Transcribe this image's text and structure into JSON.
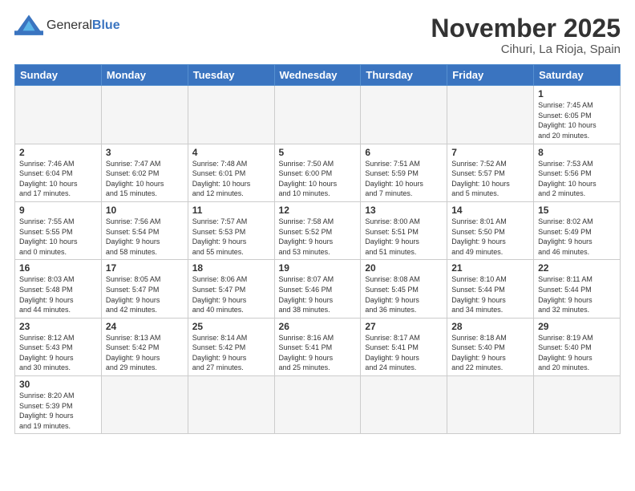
{
  "header": {
    "logo_general": "General",
    "logo_blue": "Blue",
    "month": "November 2025",
    "location": "Cihuri, La Rioja, Spain"
  },
  "weekdays": [
    "Sunday",
    "Monday",
    "Tuesday",
    "Wednesday",
    "Thursday",
    "Friday",
    "Saturday"
  ],
  "weeks": [
    [
      {
        "day": "",
        "info": ""
      },
      {
        "day": "",
        "info": ""
      },
      {
        "day": "",
        "info": ""
      },
      {
        "day": "",
        "info": ""
      },
      {
        "day": "",
        "info": ""
      },
      {
        "day": "",
        "info": ""
      },
      {
        "day": "1",
        "info": "Sunrise: 7:45 AM\nSunset: 6:05 PM\nDaylight: 10 hours\nand 20 minutes."
      }
    ],
    [
      {
        "day": "2",
        "info": "Sunrise: 7:46 AM\nSunset: 6:04 PM\nDaylight: 10 hours\nand 17 minutes."
      },
      {
        "day": "3",
        "info": "Sunrise: 7:47 AM\nSunset: 6:02 PM\nDaylight: 10 hours\nand 15 minutes."
      },
      {
        "day": "4",
        "info": "Sunrise: 7:48 AM\nSunset: 6:01 PM\nDaylight: 10 hours\nand 12 minutes."
      },
      {
        "day": "5",
        "info": "Sunrise: 7:50 AM\nSunset: 6:00 PM\nDaylight: 10 hours\nand 10 minutes."
      },
      {
        "day": "6",
        "info": "Sunrise: 7:51 AM\nSunset: 5:59 PM\nDaylight: 10 hours\nand 7 minutes."
      },
      {
        "day": "7",
        "info": "Sunrise: 7:52 AM\nSunset: 5:57 PM\nDaylight: 10 hours\nand 5 minutes."
      },
      {
        "day": "8",
        "info": "Sunrise: 7:53 AM\nSunset: 5:56 PM\nDaylight: 10 hours\nand 2 minutes."
      }
    ],
    [
      {
        "day": "9",
        "info": "Sunrise: 7:55 AM\nSunset: 5:55 PM\nDaylight: 10 hours\nand 0 minutes."
      },
      {
        "day": "10",
        "info": "Sunrise: 7:56 AM\nSunset: 5:54 PM\nDaylight: 9 hours\nand 58 minutes."
      },
      {
        "day": "11",
        "info": "Sunrise: 7:57 AM\nSunset: 5:53 PM\nDaylight: 9 hours\nand 55 minutes."
      },
      {
        "day": "12",
        "info": "Sunrise: 7:58 AM\nSunset: 5:52 PM\nDaylight: 9 hours\nand 53 minutes."
      },
      {
        "day": "13",
        "info": "Sunrise: 8:00 AM\nSunset: 5:51 PM\nDaylight: 9 hours\nand 51 minutes."
      },
      {
        "day": "14",
        "info": "Sunrise: 8:01 AM\nSunset: 5:50 PM\nDaylight: 9 hours\nand 49 minutes."
      },
      {
        "day": "15",
        "info": "Sunrise: 8:02 AM\nSunset: 5:49 PM\nDaylight: 9 hours\nand 46 minutes."
      }
    ],
    [
      {
        "day": "16",
        "info": "Sunrise: 8:03 AM\nSunset: 5:48 PM\nDaylight: 9 hours\nand 44 minutes."
      },
      {
        "day": "17",
        "info": "Sunrise: 8:05 AM\nSunset: 5:47 PM\nDaylight: 9 hours\nand 42 minutes."
      },
      {
        "day": "18",
        "info": "Sunrise: 8:06 AM\nSunset: 5:47 PM\nDaylight: 9 hours\nand 40 minutes."
      },
      {
        "day": "19",
        "info": "Sunrise: 8:07 AM\nSunset: 5:46 PM\nDaylight: 9 hours\nand 38 minutes."
      },
      {
        "day": "20",
        "info": "Sunrise: 8:08 AM\nSunset: 5:45 PM\nDaylight: 9 hours\nand 36 minutes."
      },
      {
        "day": "21",
        "info": "Sunrise: 8:10 AM\nSunset: 5:44 PM\nDaylight: 9 hours\nand 34 minutes."
      },
      {
        "day": "22",
        "info": "Sunrise: 8:11 AM\nSunset: 5:44 PM\nDaylight: 9 hours\nand 32 minutes."
      }
    ],
    [
      {
        "day": "23",
        "info": "Sunrise: 8:12 AM\nSunset: 5:43 PM\nDaylight: 9 hours\nand 30 minutes."
      },
      {
        "day": "24",
        "info": "Sunrise: 8:13 AM\nSunset: 5:42 PM\nDaylight: 9 hours\nand 29 minutes."
      },
      {
        "day": "25",
        "info": "Sunrise: 8:14 AM\nSunset: 5:42 PM\nDaylight: 9 hours\nand 27 minutes."
      },
      {
        "day": "26",
        "info": "Sunrise: 8:16 AM\nSunset: 5:41 PM\nDaylight: 9 hours\nand 25 minutes."
      },
      {
        "day": "27",
        "info": "Sunrise: 8:17 AM\nSunset: 5:41 PM\nDaylight: 9 hours\nand 24 minutes."
      },
      {
        "day": "28",
        "info": "Sunrise: 8:18 AM\nSunset: 5:40 PM\nDaylight: 9 hours\nand 22 minutes."
      },
      {
        "day": "29",
        "info": "Sunrise: 8:19 AM\nSunset: 5:40 PM\nDaylight: 9 hours\nand 20 minutes."
      }
    ],
    [
      {
        "day": "30",
        "info": "Sunrise: 8:20 AM\nSunset: 5:39 PM\nDaylight: 9 hours\nand 19 minutes."
      },
      {
        "day": "",
        "info": ""
      },
      {
        "day": "",
        "info": ""
      },
      {
        "day": "",
        "info": ""
      },
      {
        "day": "",
        "info": ""
      },
      {
        "day": "",
        "info": ""
      },
      {
        "day": "",
        "info": ""
      }
    ]
  ]
}
